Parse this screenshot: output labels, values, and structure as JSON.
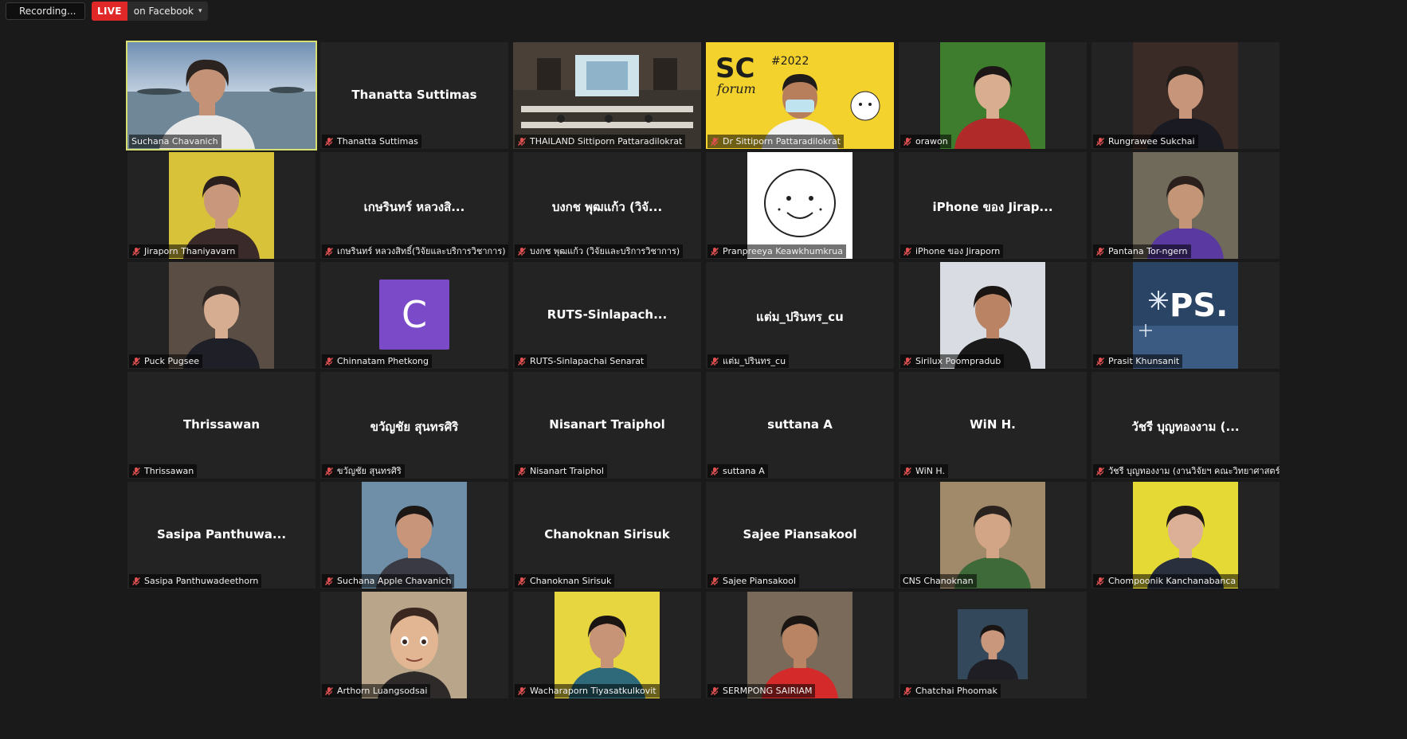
{
  "toolbar": {
    "recording_label": "Recording...",
    "live_label": "LIVE",
    "live_destination": "on Facebook"
  },
  "colors": {
    "background": "#1a1a1a",
    "tile": "#232323",
    "active_speaker_border": "#d7df72",
    "live_red": "#e02828",
    "muted_mic": "#e05050"
  },
  "participants": [
    {
      "name": "Suchana Chavanich",
      "display": "",
      "video": true,
      "muted": false,
      "active": true,
      "scene": "sea"
    },
    {
      "name": "Thanatta Suttimas",
      "display": "Thanatta Suttimas",
      "video": false,
      "muted": true
    },
    {
      "name": "THAILAND Sittiporn Pattaradilokrat",
      "display": "",
      "video": true,
      "muted": true,
      "scene": "classroom"
    },
    {
      "name": "Dr Sittiporn Pattaradilokrat",
      "display": "",
      "video": true,
      "muted": true,
      "scene": "sciforum",
      "overlay": "SC forum #2022"
    },
    {
      "name": "orawon",
      "display": "",
      "video": true,
      "muted": true,
      "scene": "portrait-green"
    },
    {
      "name": "Rungrawee Sukchai",
      "display": "",
      "video": true,
      "muted": true,
      "scene": "portrait-dark"
    },
    {
      "name": "Jiraporn Thaniyavarn",
      "display": "",
      "video": true,
      "muted": true,
      "scene": "portrait-yellow-pattern"
    },
    {
      "name": "เกษรินทร์ หลวงสิทธิ์(วิจัยและบริการวิชาการ)",
      "display": "เกษรินทร์ หลวงสิ...",
      "video": false,
      "muted": true
    },
    {
      "name": "บงกช พุฒแก้ว (วิจัยและบริการวิชาการ)",
      "display": "บงกช พุฒแก้ว (วิจั...",
      "video": false,
      "muted": true
    },
    {
      "name": "Pranpreeya Keawkhumkrua",
      "display": "",
      "video": true,
      "muted": true,
      "scene": "doodle"
    },
    {
      "name": "iPhone ของ Jiraporn",
      "display": "iPhone ของ Jirap...",
      "video": false,
      "muted": true
    },
    {
      "name": "Pantana Tor-ngern",
      "display": "",
      "video": true,
      "muted": true,
      "scene": "portrait-outdoor"
    },
    {
      "name": "Puck Pugsee",
      "display": "",
      "video": true,
      "muted": true,
      "scene": "portrait-room"
    },
    {
      "name": "Chinnatam Phetkong",
      "display": "",
      "video": false,
      "muted": true,
      "avatar_letter": "C"
    },
    {
      "name": "RUTS-Sinlapachai Senarat",
      "display": "RUTS-Sinlapach...",
      "video": false,
      "muted": true
    },
    {
      "name": "แต่ม_ปรินทร_cu",
      "display": "แต่ม_ปรินทร_cu",
      "video": false,
      "muted": true
    },
    {
      "name": "Sirilux Poompradub",
      "display": "",
      "video": true,
      "muted": true,
      "scene": "portrait-light"
    },
    {
      "name": "Prasit Khunsanit",
      "display": "",
      "video": true,
      "muted": true,
      "scene": "ps-winter",
      "overlay": "PS."
    },
    {
      "name": "Thrissawan",
      "display": "Thrissawan",
      "video": false,
      "muted": true
    },
    {
      "name": "ขวัญชัย สุนทรศิริ",
      "display": "ขวัญชัย สุนทรศิริ",
      "video": false,
      "muted": true
    },
    {
      "name": "Nisanart Traiphol",
      "display": "Nisanart Traiphol",
      "video": false,
      "muted": true
    },
    {
      "name": "suttana A",
      "display": "suttana A",
      "video": false,
      "muted": true
    },
    {
      "name": "WiN H.",
      "display": "WiN H.",
      "video": false,
      "muted": true
    },
    {
      "name": "วัชรี บุญทองงาม (งานวิจัยฯ คณะวิทยาศาสตร์)",
      "display": "วัชรี บุญทองงาม (...",
      "video": false,
      "muted": true
    },
    {
      "name": "Sasipa Panthuwadeethorn",
      "display": "Sasipa Panthuwa...",
      "video": false,
      "muted": true
    },
    {
      "name": "Suchana Apple Chavanich",
      "display": "",
      "video": true,
      "muted": true,
      "scene": "portrait-fish"
    },
    {
      "name": "Chanoknan Sirisuk",
      "display": "Chanoknan Sirisuk",
      "video": false,
      "muted": true
    },
    {
      "name": "Sajee Piansakool",
      "display": "Sajee Piansakool",
      "video": false,
      "muted": true
    },
    {
      "name": "CNS Chanoknan",
      "display": "",
      "video": true,
      "muted": false,
      "scene": "portrait-cafe"
    },
    {
      "name": "Chompoonik Kanchanabanca",
      "display": "",
      "video": true,
      "muted": true,
      "scene": "portrait-yellow"
    },
    {
      "name": "Arthorn Luangsodsai",
      "display": "",
      "video": true,
      "muted": true,
      "scene": "cartoon"
    },
    {
      "name": "Wacharaporn Tiyasatkulkovit",
      "display": "",
      "video": true,
      "muted": true,
      "scene": "portrait-yellow2"
    },
    {
      "name": "SERMPONG SAIRIAM",
      "display": "",
      "video": true,
      "muted": true,
      "scene": "portrait-red"
    },
    {
      "name": "Chatchai Phoomak",
      "display": "",
      "video": true,
      "muted": true,
      "scene": "portrait-small"
    }
  ]
}
